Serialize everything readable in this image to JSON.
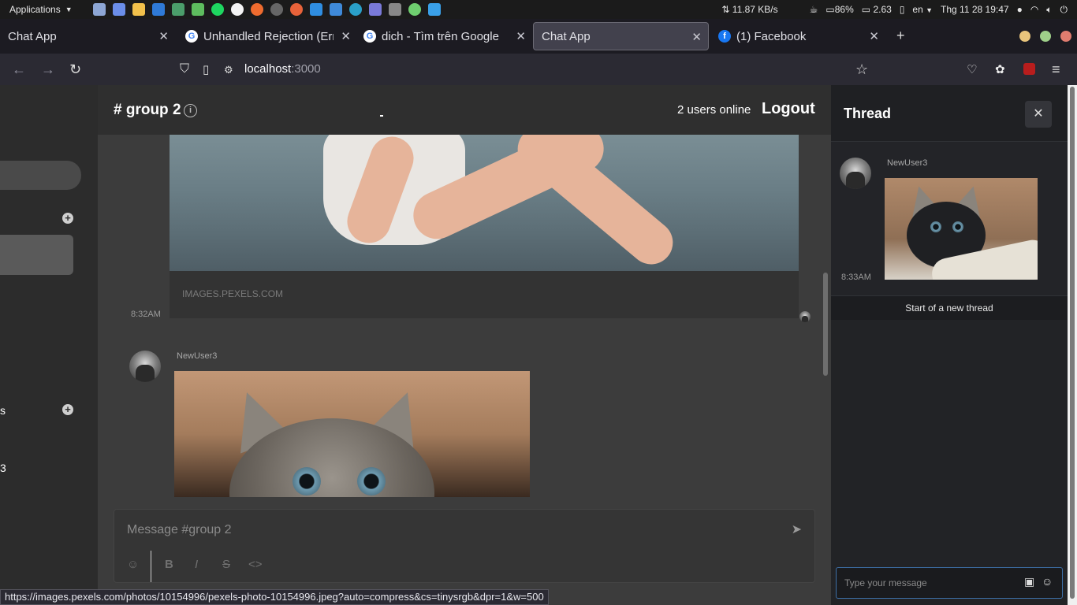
{
  "system_bar": {
    "applications_label": "Applications",
    "net_speed": "⇅ 11.87 KB/s",
    "battery": "86%",
    "load": "2.63",
    "language": "en",
    "datetime": "Thg 11 28  19:47"
  },
  "tabs": [
    {
      "label": "Chat App",
      "favicon": "none"
    },
    {
      "label": "Unhandled Rejection (Err",
      "favicon": "google"
    },
    {
      "label": "dich - Tìm trên Google",
      "favicon": "google"
    },
    {
      "label": "Chat App",
      "favicon": "none",
      "active": true
    },
    {
      "label": "(1) Facebook",
      "favicon": "facebook"
    }
  ],
  "address_bar": {
    "host": "localhost",
    "port": ":3000"
  },
  "channel": {
    "title": "# group 2",
    "online": "2 users online",
    "logout_label": "Logout"
  },
  "sidebar": {
    "label_s": "s",
    "label_3": "3"
  },
  "messages": [
    {
      "time": "8:32AM",
      "link_source": "IMAGES.PEXELS.COM"
    },
    {
      "user": "NewUser3"
    }
  ],
  "composer": {
    "placeholder": "Message #group 2",
    "format_icons": [
      "☺",
      "B",
      "I",
      "S",
      "<>"
    ]
  },
  "thread": {
    "title": "Thread",
    "close_label": "✕",
    "post": {
      "user": "NewUser3",
      "time": "8:33AM"
    },
    "start_text": "Start of a new thread",
    "input_placeholder": "Type your message"
  },
  "status_url": "https://images.pexels.com/photos/10154996/pexels-photo-10154996.jpeg?auto=compress&cs=tinysrgb&dpr=1&w=500",
  "colors": {
    "accent_blue": "#3d6fa6",
    "main_bg": "#3c3c3c",
    "thread_bg": "#222326"
  }
}
